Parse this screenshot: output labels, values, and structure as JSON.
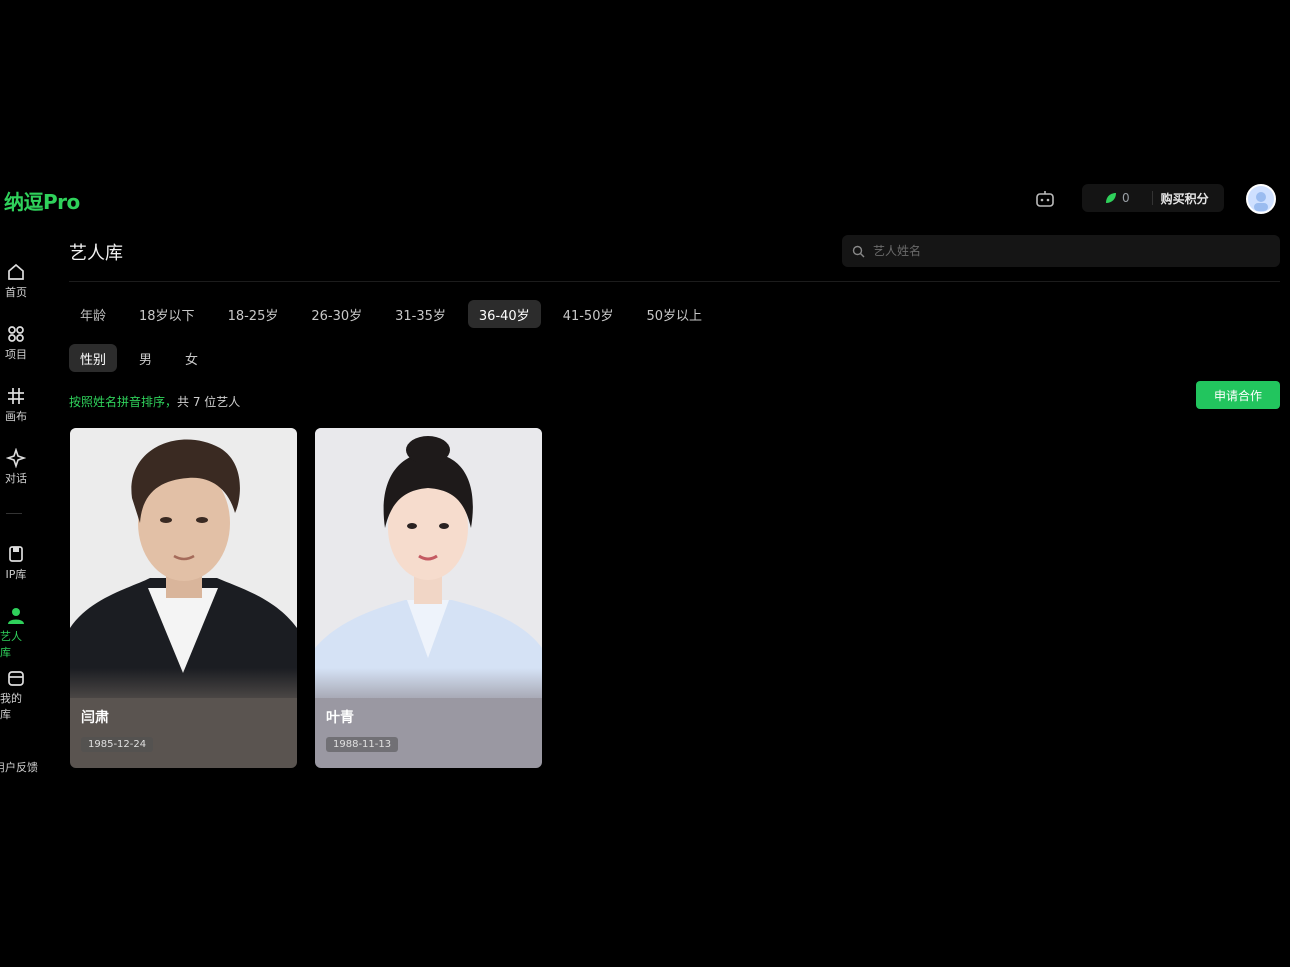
{
  "app": {
    "logo": "纳逗Pro"
  },
  "header": {
    "credits_count": "0",
    "buy_label": "购买积分"
  },
  "sidebar": {
    "items": [
      {
        "label": "首页",
        "icon": "home-icon"
      },
      {
        "label": "项目",
        "icon": "grid-icon"
      },
      {
        "label": "画布",
        "icon": "canvas-icon"
      },
      {
        "label": "对话",
        "icon": "sparkle-icon"
      },
      {
        "label": "IP库",
        "icon": "bookmark-icon"
      },
      {
        "label": "艺人库",
        "icon": "user-icon",
        "active": true
      },
      {
        "label": "我的库",
        "icon": "folder-icon"
      }
    ],
    "feedback": "用户反馈"
  },
  "main": {
    "title": "艺人库",
    "search_placeholder": "艺人姓名",
    "age_filter": {
      "label": "年龄",
      "options": [
        "18岁以下",
        "18-25岁",
        "26-30岁",
        "31-35岁",
        "36-40岁",
        "41-50岁",
        "50岁以上"
      ],
      "selected": "36-40岁"
    },
    "gender_filter": {
      "label": "性别",
      "options": [
        "男",
        "女"
      ]
    },
    "sort_text": "按照姓名拼音排序，",
    "count_text": "共 7 位艺人",
    "apply_button": "申请合作",
    "cards": [
      {
        "name": "闫肃",
        "dob": "1985-12-24"
      },
      {
        "name": "叶青",
        "dob": "1988-11-13"
      }
    ]
  },
  "colors": {
    "accent": "#2fd15b",
    "button": "#22c55e",
    "background": "#000000"
  }
}
